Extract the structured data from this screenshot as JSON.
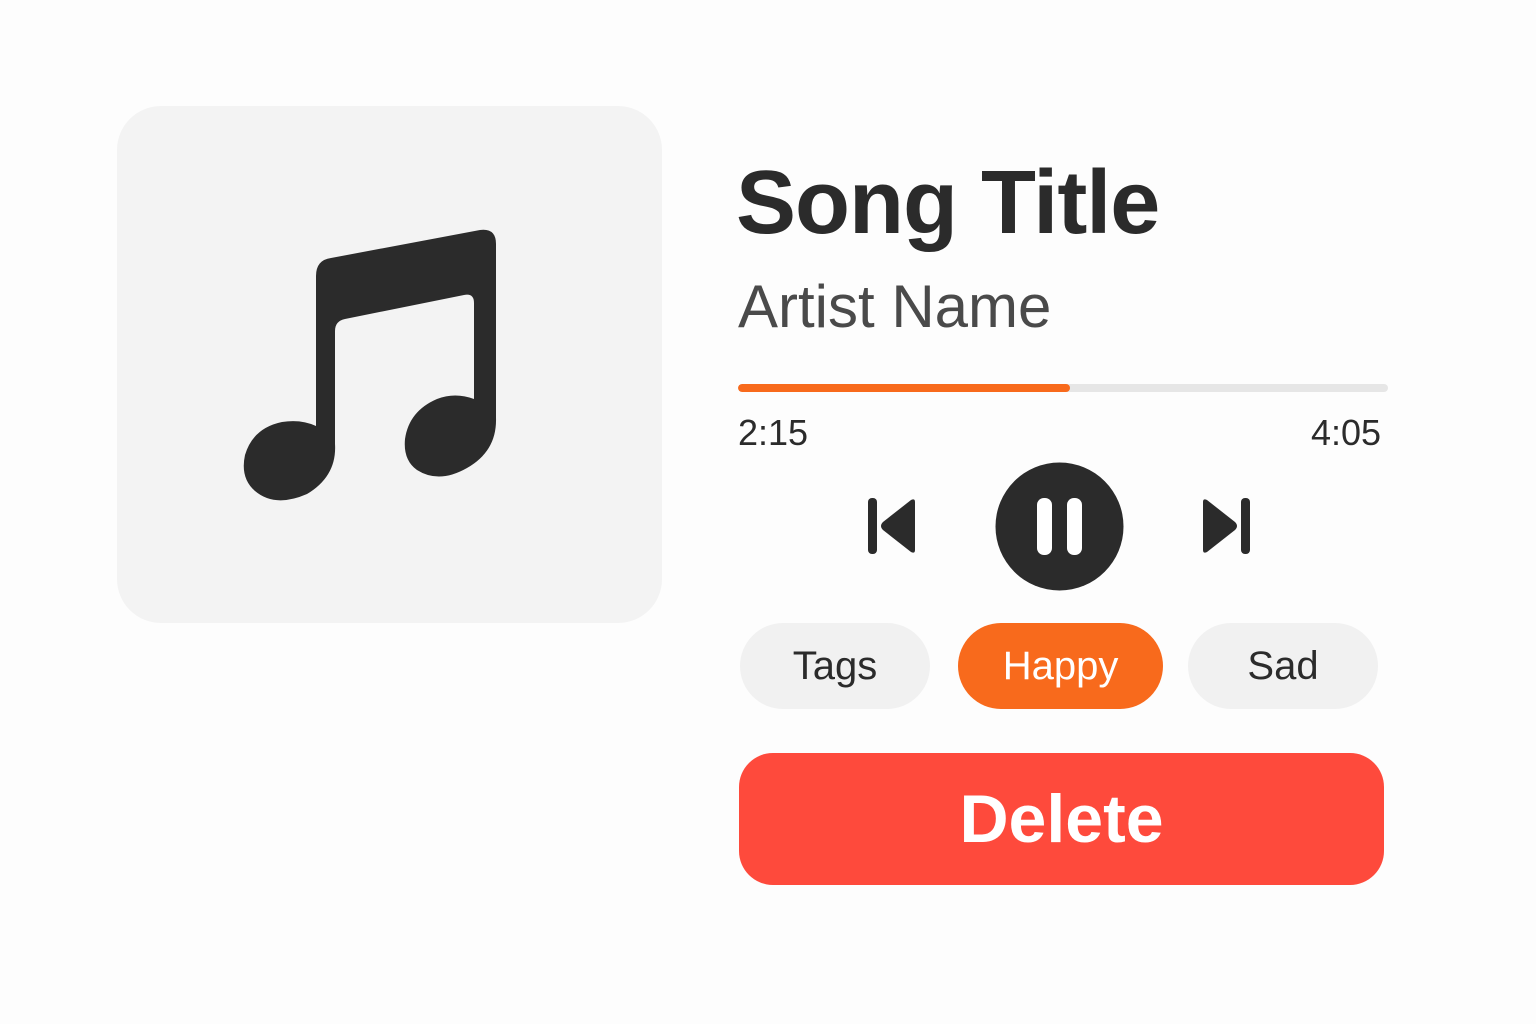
{
  "artwork": {
    "icon": "music-note-icon"
  },
  "track": {
    "title": "Song Title",
    "artist": "Artist Name"
  },
  "playback": {
    "elapsed": "2:15",
    "total": "4:05",
    "progress": 0.51,
    "state": "playing"
  },
  "controls": {
    "previous_icon": "skip-previous-icon",
    "pause_icon": "pause-icon",
    "next_icon": "skip-next-icon"
  },
  "tags": [
    {
      "label": "Tags",
      "selected": false
    },
    {
      "label": "Happy",
      "selected": true
    },
    {
      "label": "Sad",
      "selected": false
    }
  ],
  "actions": {
    "delete_label": "Delete"
  },
  "colors": {
    "accent": "#f86a1c",
    "danger": "#fe4a3c",
    "icon_dark": "#2b2b2b",
    "pill_bg": "#f1f1f1",
    "artwork_bg": "#f3f3f3"
  }
}
